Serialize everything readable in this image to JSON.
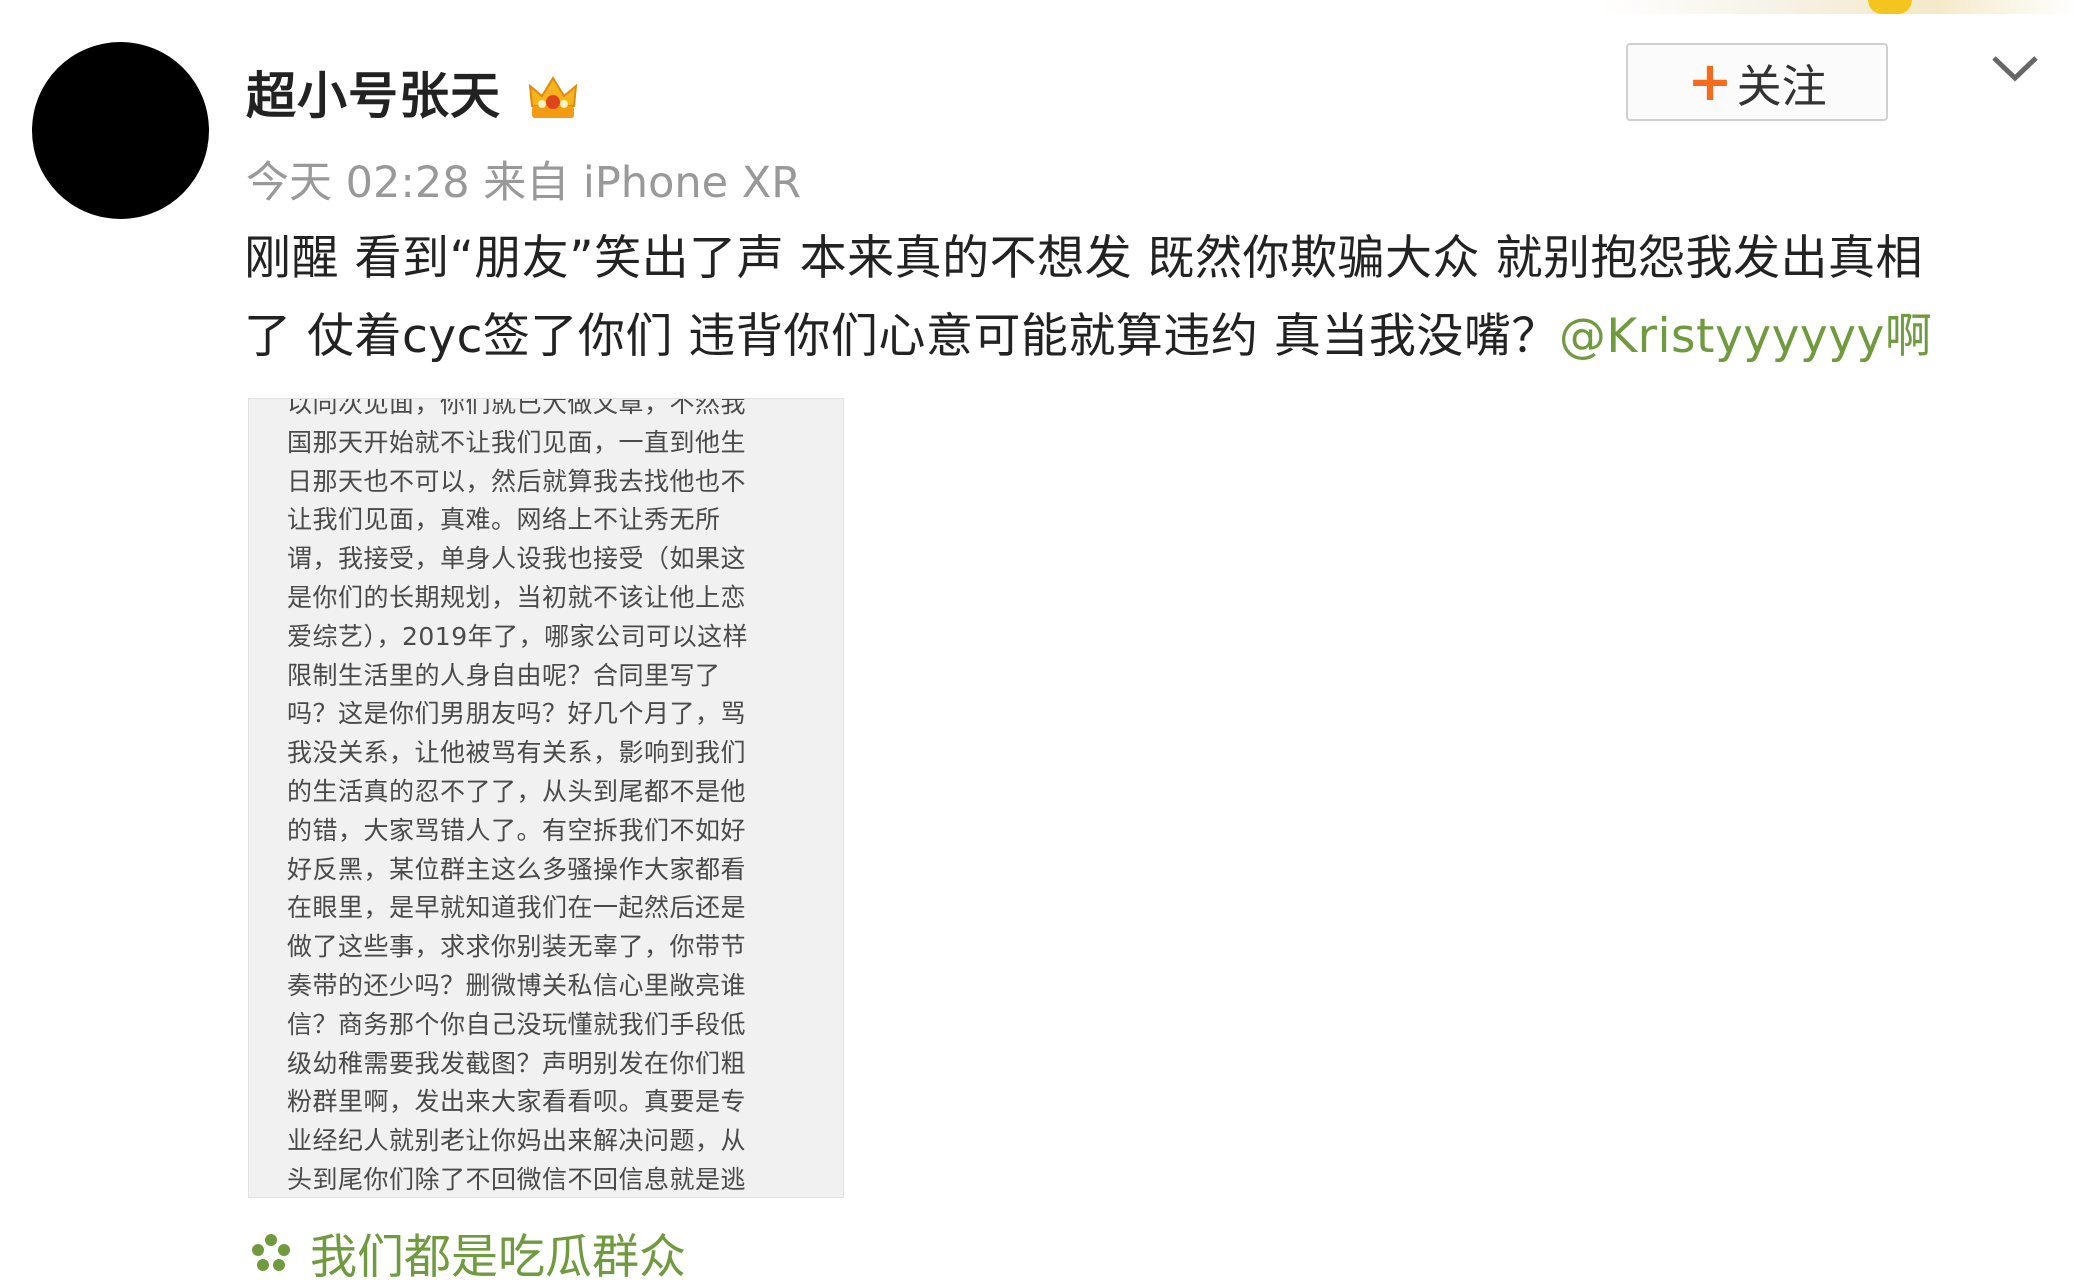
{
  "post": {
    "author": "超小号张天",
    "timestamp": "今天 02:28",
    "source": "来自 iPhone XR",
    "follow_label": "关注",
    "text_line1": "刚醒 看到“朋友”笑出了声 本来真的不想发 既然你欺骗大众 就别抱怨我发出真相",
    "text_line2": "了 仗着cyc签了你们 违背你们心意可能就算违约 真当我没嘴？",
    "mention": "@Kristyyyyyy啊",
    "topic": "我们都是吃瓜群众"
  },
  "image_text": [
    "以同次见面，你们就已大做文章，不然我",
    "国那天开始就不让我们见面，一直到他生",
    "日那天也不可以，然后就算我去找他也不",
    "让我们见面，真难。网络上不让秀无所",
    "谓，我接受，单身人设我也接受（如果这",
    "是你们的长期规划，当初就不该让他上恋",
    "爱综艺），2019年了，哪家公司可以这样",
    "限制生活里的人身自由呢？合同里写了",
    "吗？这是你们男朋友吗？好几个月了，骂",
    "我没关系，让他被骂有关系，影响到我们",
    "的生活真的忍不了了，从头到尾都不是他",
    "的错，大家骂错人了。有空拆我们不如好",
    "好反黑，某位群主这么多骚操作大家都看",
    "在眼里，是早就知道我们在一起然后还是",
    "做了这些事，求求你别装无辜了，你带节",
    "奏带的还少吗？删微博关私信心里敞亮谁",
    "信？商务那个你自己没玩懂就我们手段低",
    "级幼稚需要我发截图？声明别发在你们粗",
    "粉群里啊，发出来大家看看呗。真要是专",
    "业经纪人就别老让你妈出来解决问题，从",
    "头到尾你们除了不回微信不回信息就是逃"
  ],
  "colors": {
    "link_green": "#6f9a3e",
    "follow_plus": "#f56b1c",
    "meta_gray": "#999999"
  },
  "icons": [
    "avatar",
    "vip-crown-icon",
    "chevron-down-icon",
    "plus-icon",
    "topic-flower-icon"
  ]
}
